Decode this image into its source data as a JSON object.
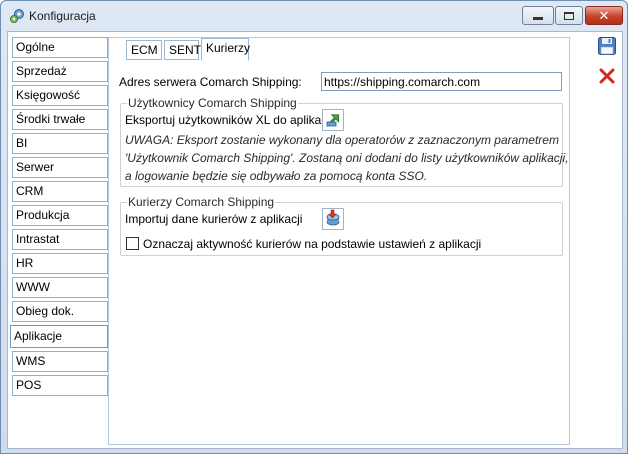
{
  "window": {
    "title": "Konfiguracja"
  },
  "nav": {
    "items": [
      {
        "label": "Ogólne"
      },
      {
        "label": "Sprzedaż"
      },
      {
        "label": "Księgowość"
      },
      {
        "label": "Środki trwałe"
      },
      {
        "label": "BI"
      },
      {
        "label": "Serwer wydruków"
      },
      {
        "label": "CRM"
      },
      {
        "label": "Produkcja"
      },
      {
        "label": "Intrastat"
      },
      {
        "label": "HR"
      },
      {
        "label": "WWW"
      },
      {
        "label": "Obieg dok."
      },
      {
        "label": "Aplikacje"
      },
      {
        "label": "WMS"
      },
      {
        "label": "POS"
      }
    ],
    "active_item": "Aplikacje"
  },
  "tabs": [
    {
      "label": "ECM"
    },
    {
      "label": "SENT"
    },
    {
      "label": "Kurierzy"
    }
  ],
  "active_tab": "Kurierzy",
  "server": {
    "label": "Adres serwera Comarch Shipping:",
    "value": "https://shipping.comarch.com"
  },
  "users_group": {
    "title": "Użytkownicy Comarch Shipping",
    "export_label": "Eksportuj użytkowników XL do aplikacji",
    "note_line1": "UWAGA: Eksport zostanie wykonany dla operatorów z zaznaczonym parametrem",
    "note_line2": "'Użytkownik Comarch Shipping'. Zostaną oni dodani do listy użytkowników aplikacji,",
    "note_line3": "a logowanie będzie się odbywało za pomocą konta SSO."
  },
  "couriers_group": {
    "title": "Kurierzy Comarch Shipping",
    "import_label": "Importuj dane kurierów z aplikacji",
    "checkbox_label": "Oznaczaj aktywność kurierów na podstawie ustawień z aplikacji",
    "checkbox_checked": false
  },
  "icons": {
    "title": "gear-icon",
    "save": "save-icon",
    "cancel": "cancel-icon",
    "export": "export-icon",
    "import": "import-icon"
  },
  "colors": {
    "cancel_red": "#d3281c",
    "close_button": "#c8432c",
    "tab_border": "#9eb7d1"
  }
}
